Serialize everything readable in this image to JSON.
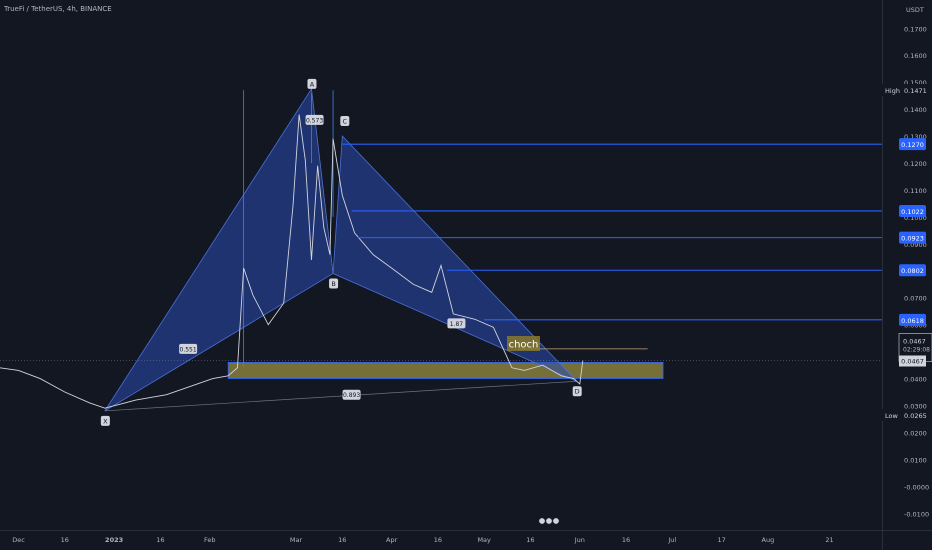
{
  "header": {
    "symbol_title": "TrueFi / TetherUS, 4h, BINANCE"
  },
  "price_axis": {
    "currency": "USDT"
  },
  "theme": {
    "background": "#131722",
    "price_line": "#d1d4dc",
    "pattern_fill": "#2a4bb0",
    "level_line": "#2962ff",
    "zone": "#c8b94b"
  },
  "chart_data": {
    "type": "line",
    "title": "",
    "xlabel": "",
    "ylabel": "",
    "ylim": [
      -0.0125,
      0.1805
    ],
    "y_ticks": [
      "0.1700",
      "0.1600",
      "0.1500",
      "0.1400",
      "0.1300",
      "0.1200",
      "0.1100",
      "0.1000",
      "0.0900",
      "0.0700",
      "0.0600",
      "0.0400",
      "0.0300",
      "0.0200",
      "0.0100",
      "-0.0000",
      "-0.0100"
    ],
    "x_ticks": [
      "Dec",
      "16",
      "2023",
      "16",
      "Feb",
      "Mar",
      "16",
      "Apr",
      "16",
      "May",
      "16",
      "Jun",
      "16",
      "Jul",
      "17",
      "Aug",
      "21"
    ],
    "price_series": {
      "x": [
        "2022-11-25",
        "2022-12-01",
        "2022-12-08",
        "2022-12-16",
        "2022-12-24",
        "2022-12-29",
        "2023-01-08",
        "2023-01-18",
        "2023-01-28",
        "2023-02-02",
        "2023-02-07",
        "2023-02-10",
        "2023-02-12",
        "2023-02-15",
        "2023-02-20",
        "2023-02-25",
        "2023-02-28",
        "2023-03-02",
        "2023-03-04",
        "2023-03-06",
        "2023-03-08",
        "2023-03-10",
        "2023-03-12",
        "2023-03-13",
        "2023-03-16",
        "2023-03-20",
        "2023-03-26",
        "2023-04-01",
        "2023-04-08",
        "2023-04-14",
        "2023-04-17",
        "2023-04-21",
        "2023-04-28",
        "2023-05-04",
        "2023-05-10",
        "2023-05-14",
        "2023-05-20",
        "2023-05-26",
        "2023-05-30",
        "2023-06-01",
        "2023-06-02"
      ],
      "y": [
        0.044,
        0.043,
        0.04,
        0.035,
        0.031,
        0.029,
        0.032,
        0.034,
        0.038,
        0.04,
        0.041,
        0.044,
        0.081,
        0.071,
        0.06,
        0.068,
        0.104,
        0.138,
        0.121,
        0.084,
        0.119,
        0.096,
        0.086,
        0.129,
        0.108,
        0.094,
        0.086,
        0.081,
        0.075,
        0.072,
        0.082,
        0.064,
        0.062,
        0.059,
        0.044,
        0.043,
        0.045,
        0.041,
        0.04,
        0.038,
        0.0467
      ]
    },
    "harmonic_pattern": {
      "points": [
        {
          "label": "X",
          "date": "2022-12-29",
          "price": 0.028
        },
        {
          "label": "A",
          "date": "2023-03-06",
          "price": 0.1475
        },
        {
          "label": "B",
          "date": "2023-03-13",
          "price": 0.079
        },
        {
          "label": "C",
          "date": "2023-03-16",
          "price": 0.13
        },
        {
          "label": "D",
          "date": "2023-05-31",
          "price": 0.039
        }
      ],
      "ratios": [
        {
          "text": "0.573",
          "date": "2023-03-07",
          "price": 0.136
        },
        {
          "text": "0.551",
          "date": "2023-01-25",
          "price": 0.051
        },
        {
          "text": "1.87",
          "date": "2023-04-22",
          "price": 0.0605
        },
        {
          "text": "0.893",
          "date": "2023-03-19",
          "price": 0.034
        }
      ]
    },
    "levels": [
      "0.1270",
      "0.1022",
      "0.0923",
      "0.0802",
      "0.0618"
    ],
    "demand_zone": {
      "top": 0.046,
      "bottom": 0.04
    },
    "choch": {
      "label": "choch",
      "price": 0.051
    },
    "current_price": {
      "value": "0.0467",
      "countdown": "02:29:08"
    },
    "high": {
      "label": "High",
      "value": "0.1471"
    },
    "low": {
      "label": "Low",
      "value": "0.0265"
    }
  }
}
